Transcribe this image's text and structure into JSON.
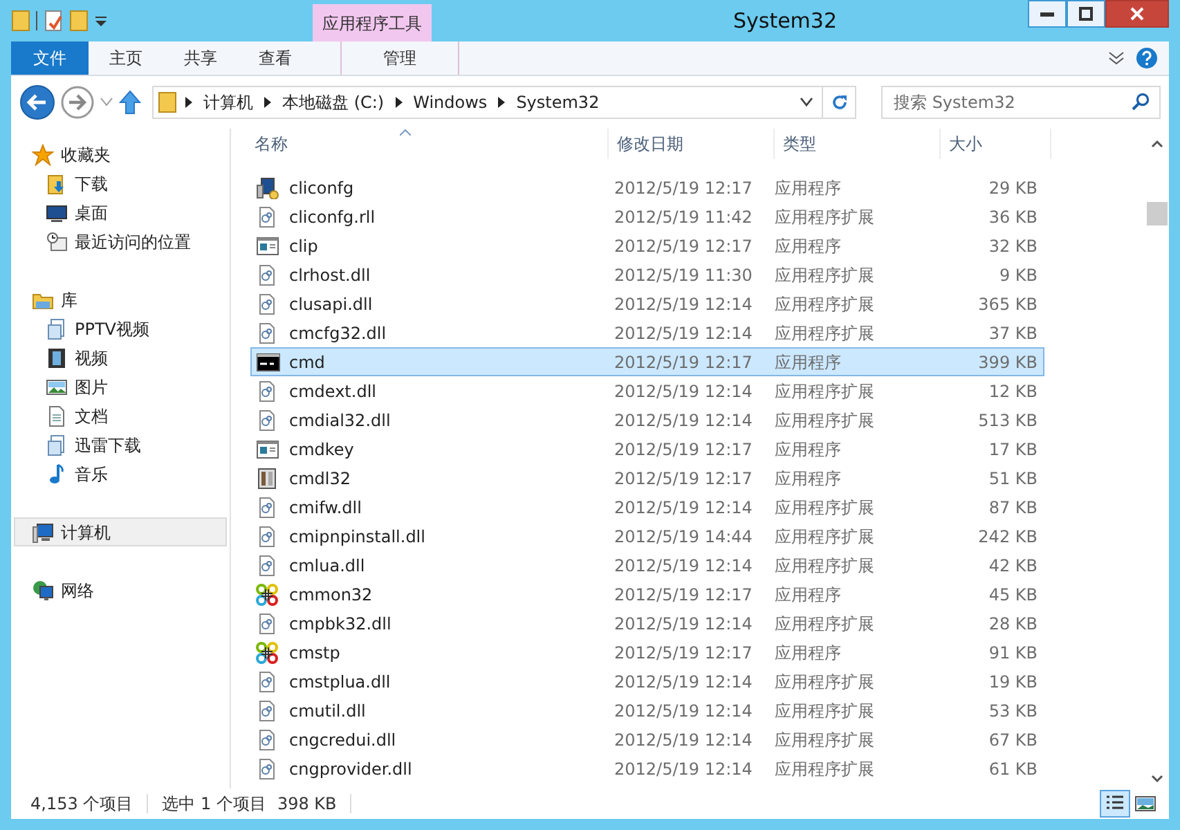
{
  "window": {
    "title": "System32",
    "context_group": "应用程序工具"
  },
  "ribbon_tabs": [
    {
      "label": "文件",
      "kind": "file",
      "selected": false
    },
    {
      "label": "主页",
      "kind": "normal",
      "selected": false
    },
    {
      "label": "共享",
      "kind": "normal",
      "selected": false
    },
    {
      "label": "查看",
      "kind": "normal",
      "selected": false
    },
    {
      "label": "管理",
      "kind": "context",
      "selected": false
    }
  ],
  "address": {
    "crumbs": [
      "计算机",
      "本地磁盘 (C:)",
      "Windows",
      "System32"
    ]
  },
  "search": {
    "placeholder": "搜索 System32"
  },
  "sidebar": {
    "items": [
      {
        "label": "收藏夹",
        "kind": "star",
        "selected": false,
        "children": [
          {
            "label": "下载",
            "kind": "download",
            "selected": false
          },
          {
            "label": "桌面",
            "kind": "desktop",
            "selected": false
          },
          {
            "label": "最近访问的位置",
            "kind": "recent",
            "selected": false
          }
        ]
      },
      {
        "label": "库",
        "kind": "library",
        "selected": false,
        "children": [
          {
            "label": "PPTV视频",
            "kind": "lib",
            "selected": false
          },
          {
            "label": "视频",
            "kind": "video",
            "selected": false
          },
          {
            "label": "图片",
            "kind": "image",
            "selected": false
          },
          {
            "label": "文档",
            "kind": "doc",
            "selected": false
          },
          {
            "label": "迅雷下载",
            "kind": "lib",
            "selected": false
          },
          {
            "label": "音乐",
            "kind": "music",
            "selected": false
          }
        ]
      },
      {
        "label": "计算机",
        "kind": "computer",
        "selected": true
      },
      {
        "label": "网络",
        "kind": "network",
        "selected": false
      }
    ]
  },
  "table": {
    "columns": [
      "名称",
      "修改日期",
      "类型",
      "大小"
    ],
    "rows": [
      {
        "name": "cliconfg",
        "date": "2012/5/19 12:17",
        "type": "应用程序",
        "size": "29 KB",
        "kind": "config",
        "selected": false
      },
      {
        "name": "cliconfg.rll",
        "date": "2012/5/19 11:42",
        "type": "应用程序扩展",
        "size": "36 KB",
        "kind": "dll",
        "selected": false
      },
      {
        "name": "clip",
        "date": "2012/5/19 12:17",
        "type": "应用程序",
        "size": "32 KB",
        "kind": "window",
        "selected": false
      },
      {
        "name": "clrhost.dll",
        "date": "2012/5/19 11:30",
        "type": "应用程序扩展",
        "size": "9 KB",
        "kind": "dll",
        "selected": false
      },
      {
        "name": "clusapi.dll",
        "date": "2012/5/19 12:14",
        "type": "应用程序扩展",
        "size": "365 KB",
        "kind": "dll",
        "selected": false
      },
      {
        "name": "cmcfg32.dll",
        "date": "2012/5/19 12:14",
        "type": "应用程序扩展",
        "size": "37 KB",
        "kind": "dll",
        "selected": false
      },
      {
        "name": "cmd",
        "date": "2012/5/19 12:17",
        "type": "应用程序",
        "size": "399 KB",
        "kind": "console",
        "selected": true
      },
      {
        "name": "cmdext.dll",
        "date": "2012/5/19 12:14",
        "type": "应用程序扩展",
        "size": "12 KB",
        "kind": "dll",
        "selected": false
      },
      {
        "name": "cmdial32.dll",
        "date": "2012/5/19 12:14",
        "type": "应用程序扩展",
        "size": "513 KB",
        "kind": "dll",
        "selected": false
      },
      {
        "name": "cmdkey",
        "date": "2012/5/19 12:17",
        "type": "应用程序",
        "size": "17 KB",
        "kind": "window",
        "selected": false
      },
      {
        "name": "cmdl32",
        "date": "2012/5/19 12:17",
        "type": "应用程序",
        "size": "51 KB",
        "kind": "server",
        "selected": false
      },
      {
        "name": "cmifw.dll",
        "date": "2012/5/19 12:14",
        "type": "应用程序扩展",
        "size": "87 KB",
        "kind": "dll",
        "selected": false
      },
      {
        "name": "cmipnpinstall.dll",
        "date": "2012/5/19 14:44",
        "type": "应用程序扩展",
        "size": "242 KB",
        "kind": "dll",
        "selected": false
      },
      {
        "name": "cmlua.dll",
        "date": "2012/5/19 12:14",
        "type": "应用程序扩展",
        "size": "42 KB",
        "kind": "dll",
        "selected": false
      },
      {
        "name": "cmmon32",
        "date": "2012/5/19 12:17",
        "type": "应用程序",
        "size": "45 KB",
        "kind": "knot",
        "selected": false
      },
      {
        "name": "cmpbk32.dll",
        "date": "2012/5/19 12:14",
        "type": "应用程序扩展",
        "size": "28 KB",
        "kind": "dll",
        "selected": false
      },
      {
        "name": "cmstp",
        "date": "2012/5/19 12:17",
        "type": "应用程序",
        "size": "91 KB",
        "kind": "knot",
        "selected": false
      },
      {
        "name": "cmstplua.dll",
        "date": "2012/5/19 12:14",
        "type": "应用程序扩展",
        "size": "19 KB",
        "kind": "dll",
        "selected": false
      },
      {
        "name": "cmutil.dll",
        "date": "2012/5/19 12:14",
        "type": "应用程序扩展",
        "size": "53 KB",
        "kind": "dll",
        "selected": false
      },
      {
        "name": "cngcredui.dll",
        "date": "2012/5/19 12:14",
        "type": "应用程序扩展",
        "size": "67 KB",
        "kind": "dll",
        "selected": false
      },
      {
        "name": "cngprovider.dll",
        "date": "2012/5/19 12:14",
        "type": "应用程序扩展",
        "size": "61 KB",
        "kind": "dll",
        "selected": false
      }
    ]
  },
  "status_bar": {
    "count": "4,153 个项目",
    "selection": "选中 1 个项目",
    "selection_size": "398 KB"
  },
  "view_buttons": [
    {
      "kind": "details",
      "selected": true
    },
    {
      "kind": "large",
      "selected": false
    }
  ]
}
